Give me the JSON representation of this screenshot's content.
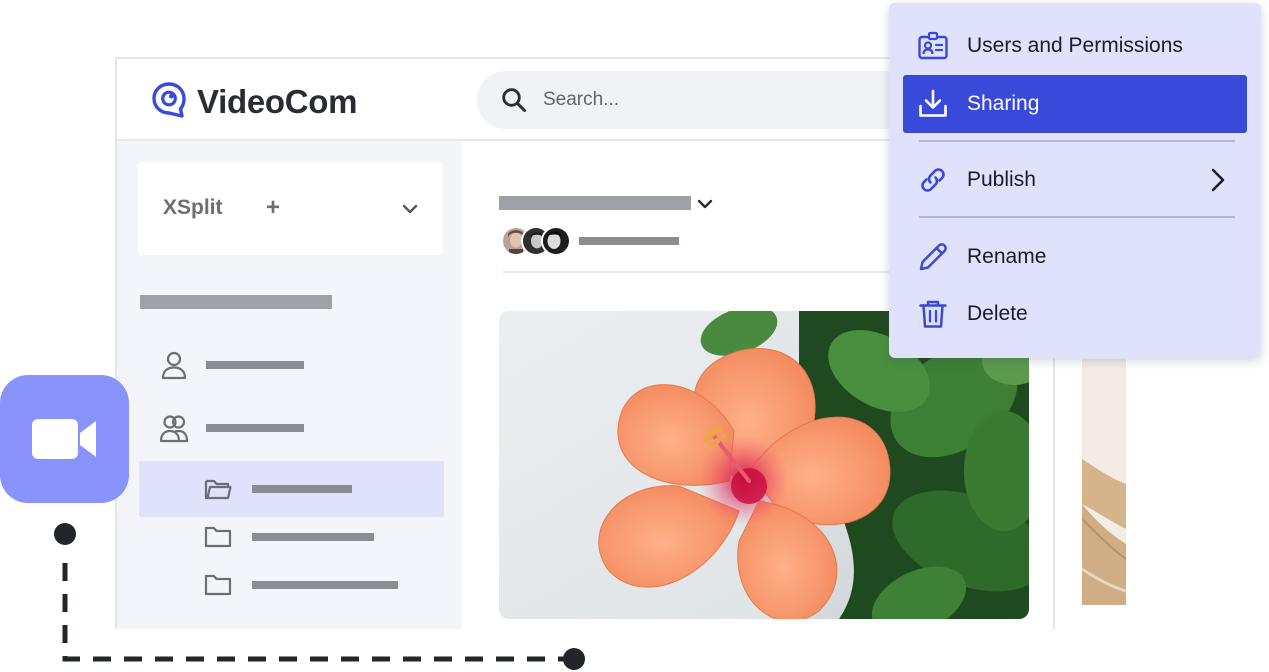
{
  "app": {
    "brand_name": "VideoCom",
    "brand_color": "#3949d9",
    "logo_icon": "chat-bubble-eye-icon"
  },
  "search": {
    "placeholder": "Search...",
    "value": "",
    "icon": "search-icon"
  },
  "sidebar": {
    "workspace": {
      "name": "XSplit",
      "add_label": "+",
      "dropdown_icon": "chevron-down-icon"
    },
    "items": [
      {
        "icon": "user-icon",
        "active": false
      },
      {
        "icon": "users-icon",
        "active": false
      },
      {
        "icon": "folder-open-icon",
        "active": true
      },
      {
        "icon": "folder-icon",
        "active": false
      },
      {
        "icon": "folder-icon",
        "active": false
      }
    ]
  },
  "content": {
    "title_dropdown_icon": "chevron-down-icon",
    "member_avatars": 3,
    "photo_subject": "orange hibiscus flower with green leaves"
  },
  "video_badge": {
    "icon": "video-camera-icon",
    "color": "#8893fc"
  },
  "context_menu": {
    "background": "#e0e1fb",
    "selected_color": "#3949d9",
    "items": [
      {
        "label": "Users and Permissions",
        "icon": "id-card-icon",
        "selected": false
      },
      {
        "label": "Sharing",
        "icon": "download-icon",
        "selected": true
      },
      {
        "label": "Publish",
        "icon": "link-icon",
        "selected": false,
        "submenu": true
      },
      {
        "label": "Rename",
        "icon": "pencil-icon",
        "selected": false
      },
      {
        "label": "Delete",
        "icon": "trash-icon",
        "selected": false
      }
    ]
  }
}
